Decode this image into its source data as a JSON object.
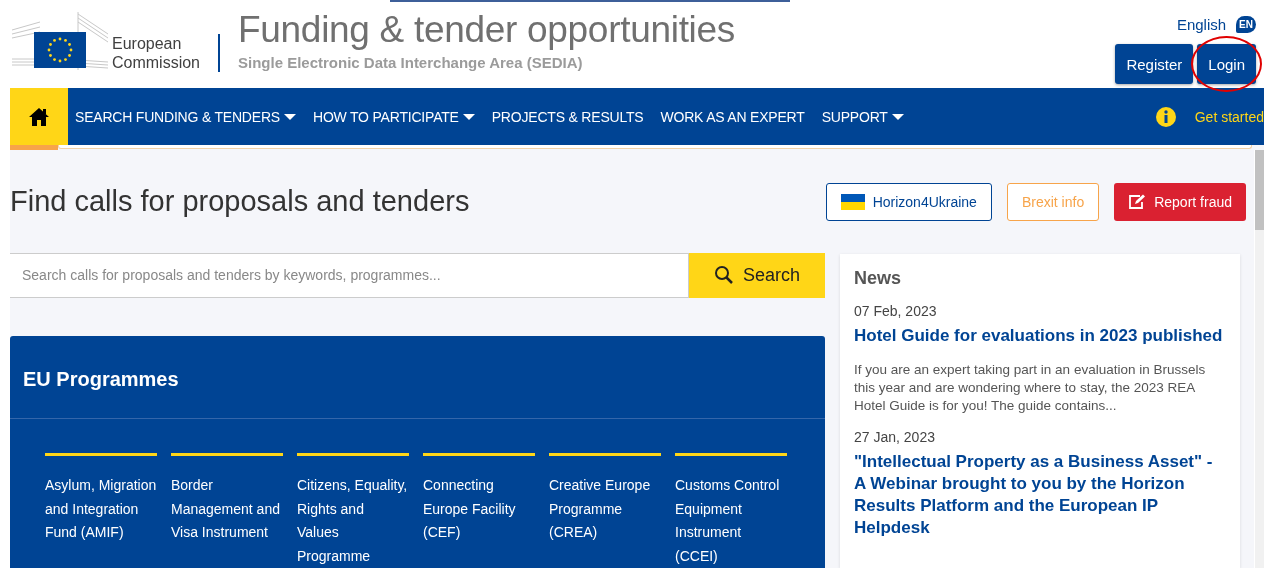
{
  "header": {
    "logo_text": "European Commission",
    "title": "Funding & tender opportunities",
    "subtitle": "Single Electronic Data Interchange Area (SEDIA)",
    "language": "English",
    "language_badge": "EN",
    "buttons": [
      {
        "label": "Register",
        "circled": false
      },
      {
        "label": "Login",
        "circled": true
      }
    ]
  },
  "nav": {
    "items": [
      {
        "label": "SEARCH FUNDING & TENDERS",
        "dropdown": true
      },
      {
        "label": "HOW TO PARTICIPATE",
        "dropdown": true
      },
      {
        "label": "PROJECTS & RESULTS",
        "dropdown": false
      },
      {
        "label": "WORK AS AN EXPERT",
        "dropdown": false
      },
      {
        "label": "SUPPORT",
        "dropdown": true
      }
    ],
    "info_link": "Get started"
  },
  "main": {
    "heading": "Find calls for proposals and tenders",
    "actions": [
      {
        "label": "Horizon4Ukraine",
        "kind": "ukraine"
      },
      {
        "label": "Brexit info",
        "kind": "outline"
      },
      {
        "label": "Report fraud",
        "kind": "danger"
      }
    ],
    "search": {
      "placeholder": "Search calls for proposals and tenders by keywords, programmes...",
      "button": "Search"
    },
    "programmes": {
      "title": "EU Programmes",
      "items": [
        "Asylum, Migration and Integration Fund (AMIF)",
        "Border Management and Visa Instrument",
        "Citizens, Equality, Rights and Values Programme",
        "Connecting Europe Facility (CEF)",
        "Creative Europe Programme (CREA)",
        "Customs Control Equipment Instrument (CCEI)"
      ]
    }
  },
  "news": {
    "title": "News",
    "items": [
      {
        "date": "07 Feb, 2023",
        "title": "Hotel Guide for evaluations in 2023 published",
        "summary": "If you are an expert taking part in an evaluation in Brussels this year and are wondering where to stay, the 2023 REA Hotel Guide is for you! The guide contains..."
      },
      {
        "date": "27 Jan, 2023",
        "title": "\"Intellectual Property as a Business Asset\" - A Webinar brought to you by the Horizon Results Platform and the European IP Helpdesk"
      }
    ]
  }
}
